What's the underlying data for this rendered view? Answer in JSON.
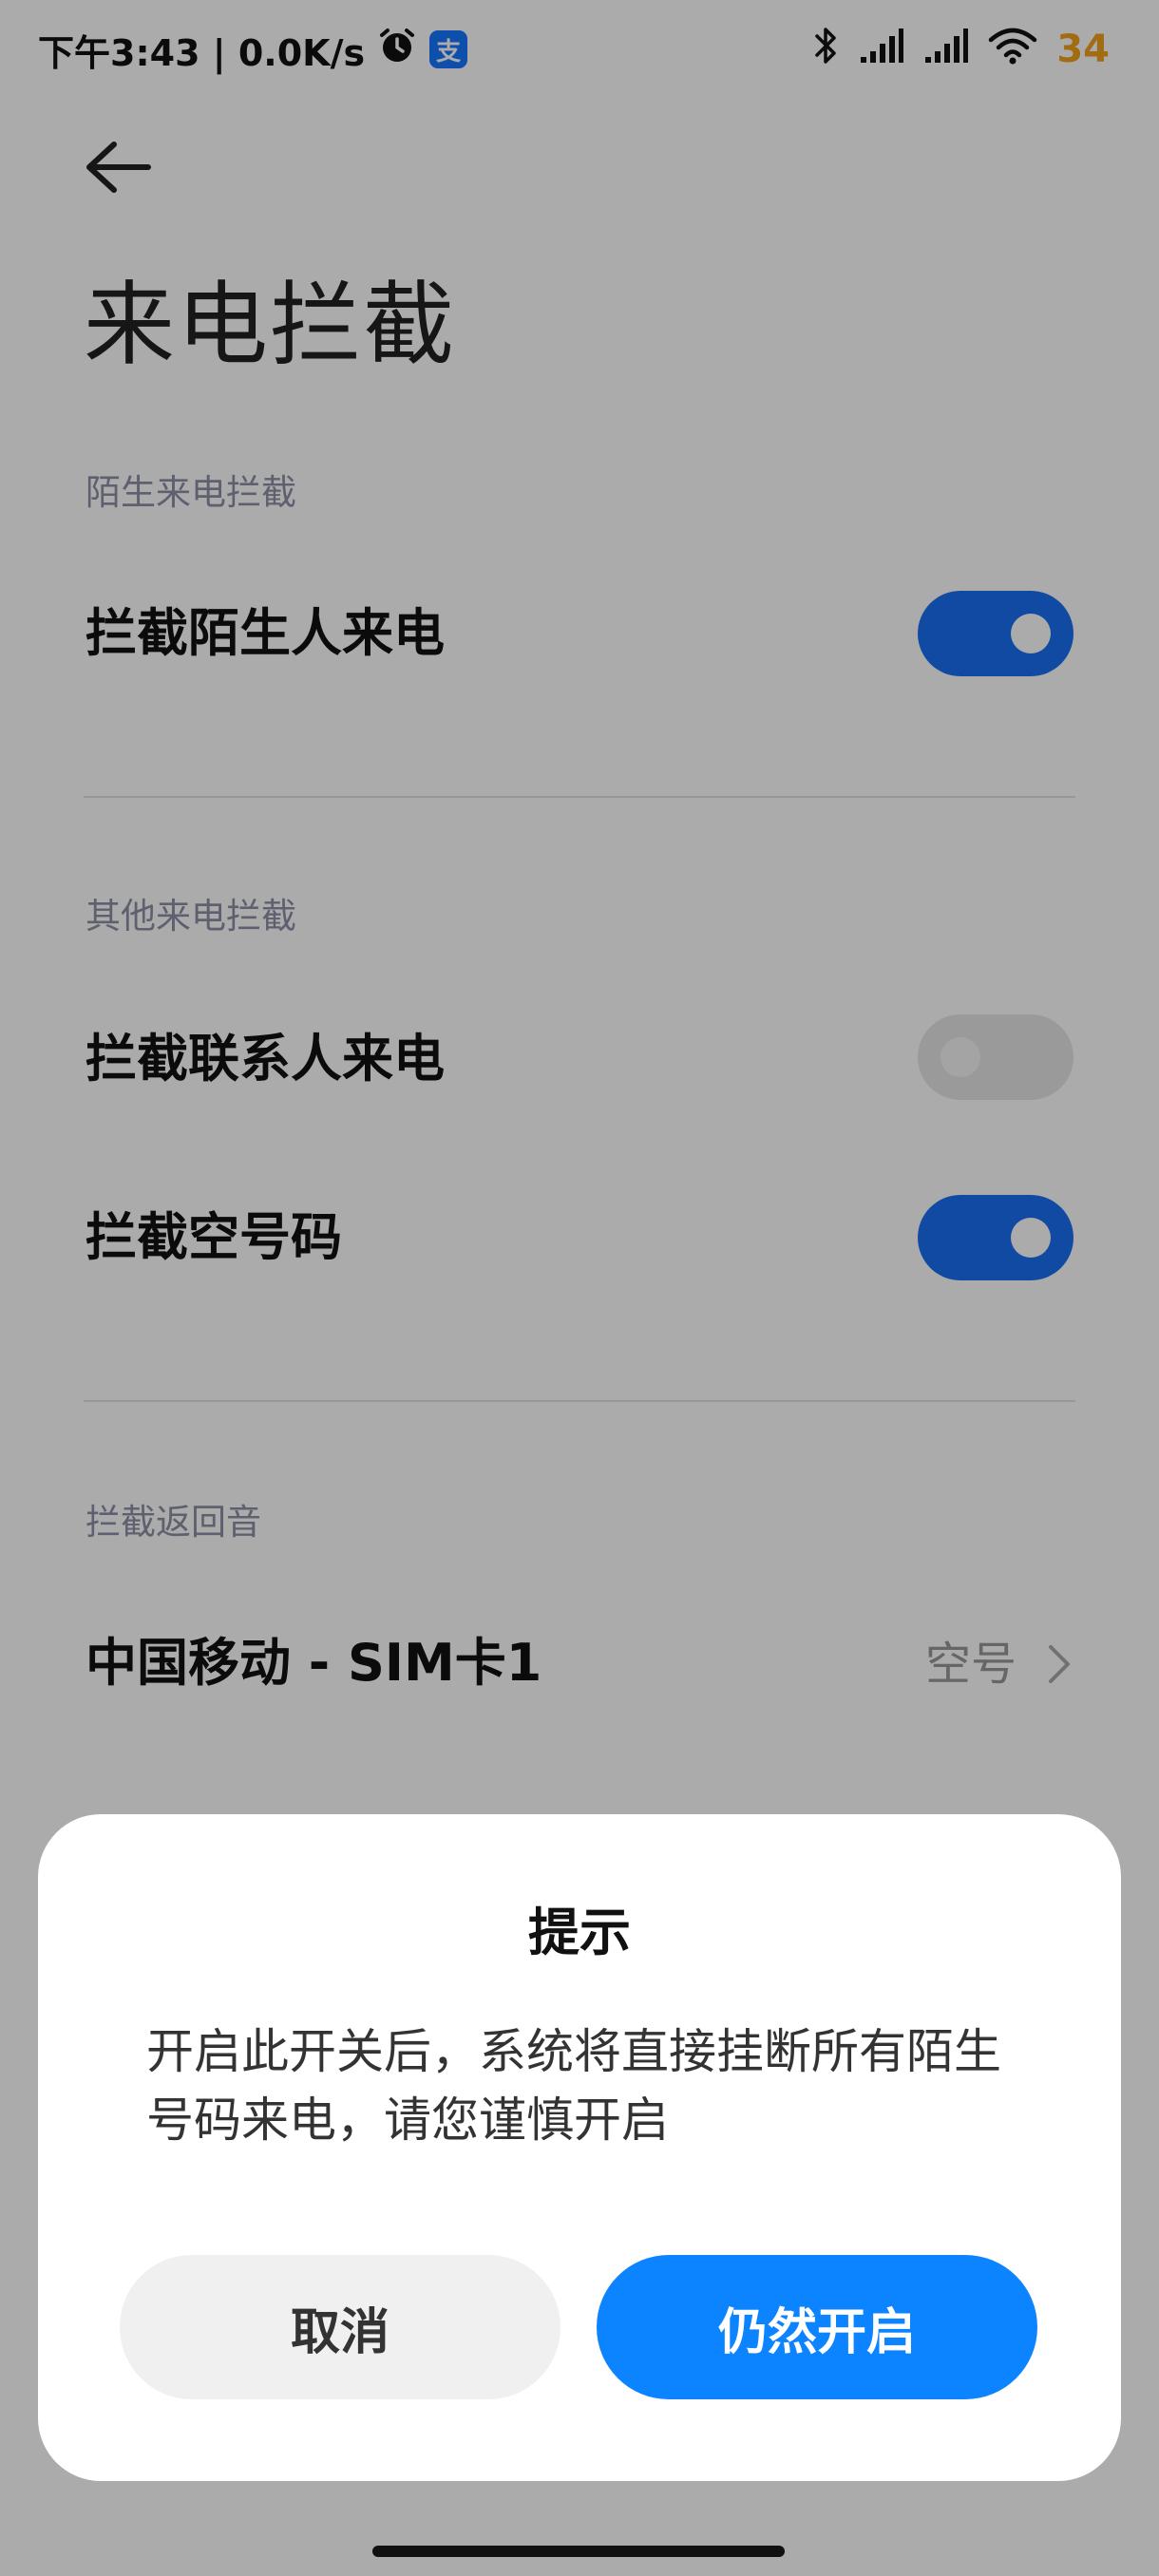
{
  "status_bar": {
    "time_speed": "下午3:43 | 0.0K/s",
    "alipay_glyph": "支",
    "battery": "34"
  },
  "page": {
    "title": "来电拦截",
    "sections": [
      {
        "header": "陌生来电拦截",
        "rows": [
          {
            "label": "拦截陌生人来电",
            "toggle": "on"
          }
        ]
      },
      {
        "header": "其他来电拦截",
        "rows": [
          {
            "label": "拦截联系人来电",
            "toggle": "off"
          },
          {
            "label": "拦截空号码",
            "toggle": "on"
          }
        ]
      },
      {
        "header": "拦截返回音",
        "rows": [
          {
            "label": "中国移动 - SIM卡1",
            "value": "空号"
          }
        ]
      }
    ]
  },
  "dialog": {
    "title": "提示",
    "message": "开启此开关后，系统将直接挂断所有陌生号码来电，请您谨慎开启",
    "cancel_label": "取消",
    "confirm_label": "仍然开启"
  },
  "colors": {
    "accent": "#1a6ff2",
    "confirm_button": "#0d84ff",
    "battery": "#f2a11c"
  }
}
